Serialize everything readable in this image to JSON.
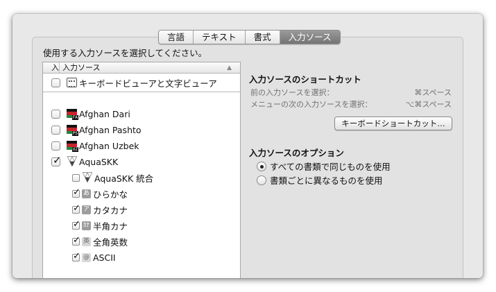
{
  "tabs": [
    {
      "label": "言語",
      "active": false
    },
    {
      "label": "テキスト",
      "active": false
    },
    {
      "label": "書式",
      "active": false
    },
    {
      "label": "入力ソース",
      "active": true
    }
  ],
  "instruction": "使用する入力ソースを選択してください。",
  "list": {
    "header_on": "入",
    "header_name": "入力ソース",
    "items": [
      {
        "label": "キーボードビューアと文字ビューア",
        "checked": false,
        "icon": "keyboard-viewer-icon"
      },
      {
        "label": "Afghan Dari",
        "checked": false,
        "icon": "afghanistan-flag-icon",
        "badge": "FA"
      },
      {
        "label": "Afghan Pashto",
        "checked": false,
        "icon": "afghanistan-flag-icon",
        "badge": "PS"
      },
      {
        "label": "Afghan Uzbek",
        "checked": false,
        "icon": "afghanistan-flag-icon",
        "badge": "UZ"
      },
      {
        "label": "AquaSKK",
        "checked": true,
        "icon": "aquaskk-icon"
      },
      {
        "label": "AquaSKK 統合",
        "checked": false,
        "icon": "aquaskk-icon"
      },
      {
        "label": "ひらかな",
        "checked": true,
        "icon": "hiragana-mode-icon",
        "glyph": "あ"
      },
      {
        "label": "カタカナ",
        "checked": true,
        "icon": "katakana-mode-icon",
        "glyph": "ア"
      },
      {
        "label": "半角カナ",
        "checked": true,
        "icon": "halfwidth-kana-mode-icon",
        "glyph": "ｶﾅ"
      },
      {
        "label": "全角英数",
        "checked": true,
        "icon": "fullwidth-alnum-mode-icon",
        "glyph": "英"
      },
      {
        "label": "ASCII",
        "checked": true,
        "icon": "ascii-mode-icon",
        "glyph": "@"
      }
    ]
  },
  "shortcuts": {
    "title": "入力ソースのショートカット",
    "prev_label": "前の入力ソースを選択：",
    "prev_key": "⌘スペース",
    "next_label": "メニューの次の入力ソースを選択：",
    "next_key": "⌥⌘スペース",
    "button": "キーボードショートカット…"
  },
  "options": {
    "title": "入力ソースのオプション",
    "radios": [
      {
        "label": "すべての書類で同じものを使用",
        "selected": true
      },
      {
        "label": "書類ごとに異なるものを使用",
        "selected": false
      }
    ]
  }
}
